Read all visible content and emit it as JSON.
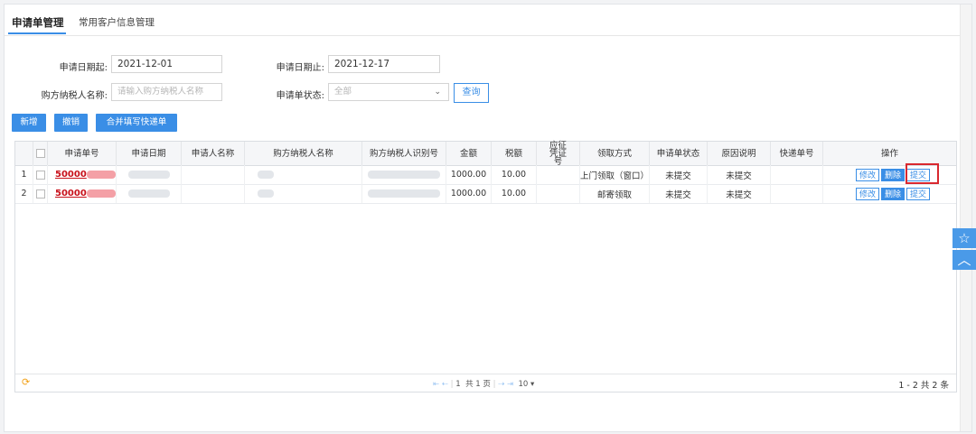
{
  "tabs": [
    {
      "label": "申请单管理"
    },
    {
      "label": "常用客户信息管理"
    }
  ],
  "filters": {
    "date_start": {
      "label": "申请日期起:",
      "value": "2021-12-01"
    },
    "date_end": {
      "label": "申请日期止:",
      "value": "2021-12-17"
    },
    "buyer_name": {
      "label": "购方纳税人名称:",
      "placeholder": "请输入购方纳税人名称"
    },
    "status": {
      "label": "申请单状态:",
      "value": "全部"
    },
    "query_label": "查询"
  },
  "toolbar": {
    "new_label": "新增",
    "revoke_label": "撤销",
    "merge_label": "合并填写快递单"
  },
  "table": {
    "columns": [
      "申请单号",
      "申请日期",
      "申请人名称",
      "购方纳税人名称",
      "购方纳税人识别号",
      "金额",
      "税额",
      "应征凭证号",
      "领取方式",
      "申请单状态",
      "原因说明",
      "快递单号",
      "操作"
    ],
    "rows": [
      {
        "index": "1",
        "id": "50000",
        "amount": "1000.00",
        "tax": "10.00",
        "voucher": "",
        "pickup": "上门领取（窗口）",
        "status": "未提交",
        "reason": "未提交",
        "express": "",
        "actions": {
          "edit": "修改",
          "delete": "删除",
          "submit": "提交"
        }
      },
      {
        "index": "2",
        "id": "50000",
        "amount": "1000.00",
        "tax": "10.00",
        "voucher": "",
        "pickup": "邮寄领取",
        "status": "未提交",
        "reason": "未提交",
        "express": "",
        "actions": {
          "edit": "修改",
          "delete": "删除",
          "submit": "提交"
        }
      }
    ]
  },
  "pager": {
    "first": "⇤",
    "prev": "⇠",
    "page": "1",
    "total_pages": "共 1 页",
    "next": "⇢",
    "last": "⇥",
    "page_size": "10 ▾",
    "summary": "1 - 2   共 2 条"
  },
  "colors": {
    "accent": "#3a8ee6",
    "highlight": "#d9282f",
    "link": "#c8101a"
  }
}
